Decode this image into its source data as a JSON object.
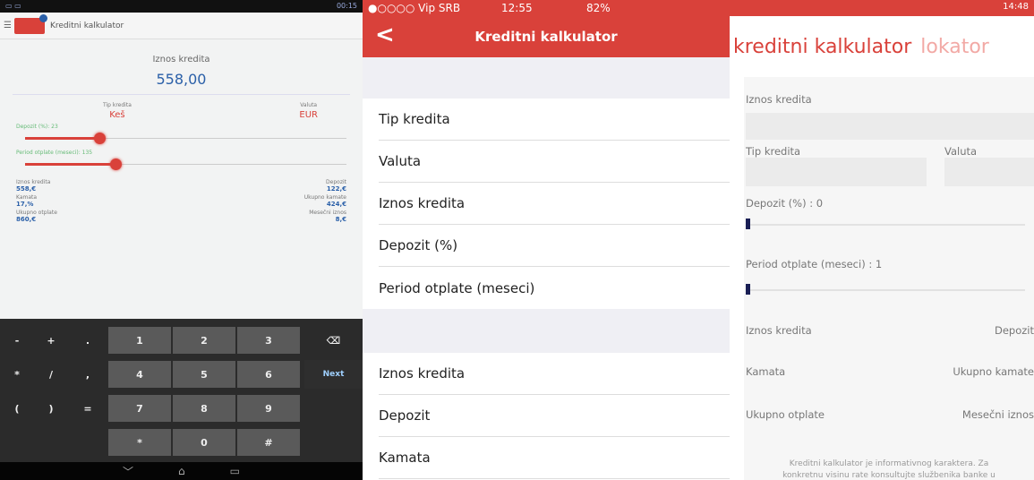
{
  "android": {
    "status_time": "00:15",
    "app_title": "Kreditni kalkulator",
    "amount_label": "Iznos kredita",
    "amount_value": "558,00",
    "loan_type_label": "Tip kredita",
    "loan_type_value": "Keš",
    "currency_label": "Valuta",
    "currency_value": "EUR",
    "deposit_label": "Depozit (%): 23",
    "deposit_level": 0.23,
    "period_label": "Period otplate (meseci): 135",
    "period_level": 0.28,
    "results": [
      {
        "left_label": "Iznos kredita",
        "left_value": "558,€",
        "right_label": "Depozit",
        "right_value": "122,€"
      },
      {
        "left_label": "Kamata",
        "left_value": "17,%",
        "right_label": "Ukupno kamate",
        "right_value": "424,€"
      },
      {
        "left_label": "Ukupno otplate",
        "left_value": "860,€",
        "right_label": "Mesečni iznos",
        "right_value": "8,€"
      }
    ],
    "keys": {
      "row1": [
        "-",
        "+",
        ".",
        "1",
        "2",
        "3",
        "⌫"
      ],
      "row2": [
        "*",
        "/",
        ",",
        "4",
        "5",
        "6",
        "Next"
      ],
      "row3": [
        "(",
        ")",
        "=",
        "7",
        "8",
        "9",
        ""
      ],
      "row4": [
        "",
        "",
        "",
        "*",
        "0",
        "#",
        ""
      ]
    },
    "nav": [
      "﹀",
      "⌂",
      "▭"
    ]
  },
  "ios": {
    "carrier": "●○○○○ Vip SRB",
    "time": "12:55",
    "battery": "82%",
    "title": "Kreditni kalkulator",
    "back_icon": "chevron-left-icon",
    "rows_top": [
      "Tip kredita",
      "Valuta",
      "Iznos kredita",
      "Depozit (%)",
      "Period otplate (meseci)"
    ],
    "rows_bottom": [
      "Iznos kredita",
      "Depozit",
      "Kamata"
    ]
  },
  "wp": {
    "time": "14:48",
    "pivot_active": "kreditni kalkulator",
    "pivot_next": "lokator",
    "amount_label": "Iznos kredita",
    "loan_type_label": "Tip kredita",
    "currency_label": "Valuta",
    "deposit_label": "Depozit (%) : 0",
    "period_label": "Period otplate (meseci) : 1",
    "results": [
      {
        "left": "Iznos kredita",
        "right": "Depozit"
      },
      {
        "left": "Kamata",
        "right": "Ukupno kamate"
      },
      {
        "left": "Ukupno otplate",
        "right": "Mesečni iznos"
      }
    ],
    "note_line1": "Kreditni kalkulator je informativnog karaktera. Za",
    "note_line2": "konkretnu visinu rate konsultujte službenika banke u"
  }
}
